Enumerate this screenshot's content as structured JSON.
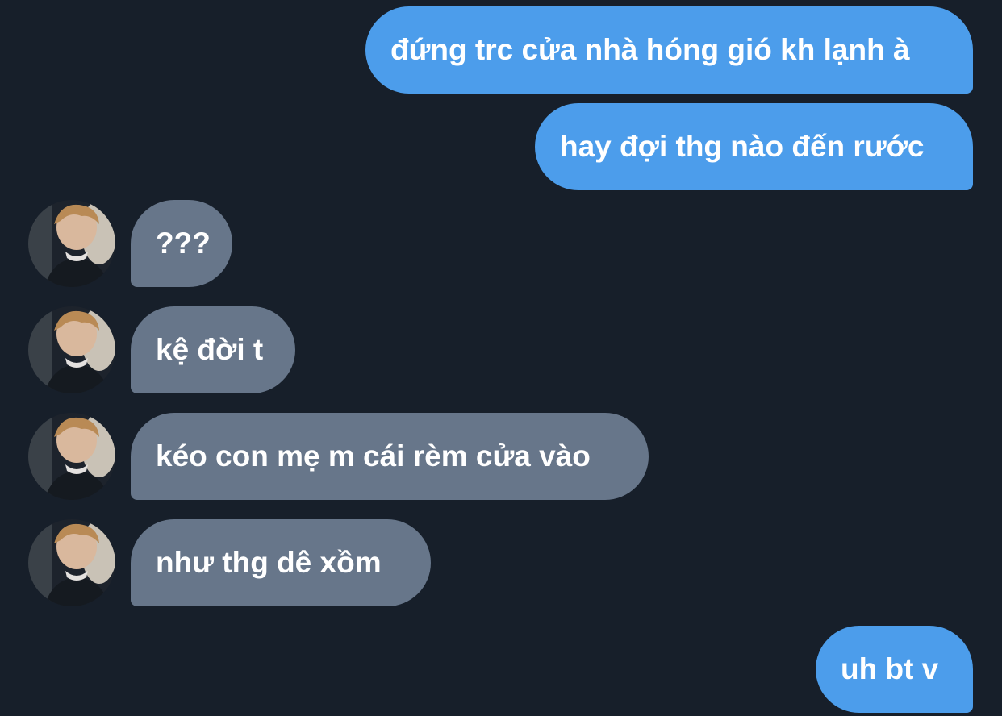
{
  "conversation": {
    "messages": [
      {
        "sender": "me",
        "text": "đứng trc cửa nhà hóng gió kh lạnh à"
      },
      {
        "sender": "me",
        "text": "hay đợi thg nào đến rước"
      },
      {
        "sender": "other",
        "text": "???"
      },
      {
        "sender": "other",
        "text": "kệ đời t"
      },
      {
        "sender": "other",
        "text": "kéo con mẹ m cái rèm cửa vào"
      },
      {
        "sender": "other",
        "text": "như thg dê xồm"
      },
      {
        "sender": "me",
        "text": "uh bt v"
      }
    ]
  },
  "colors": {
    "background": "#171f2a",
    "sent_bubble": "#4c9deb",
    "received_bubble": "#67768a",
    "text": "#ffffff"
  },
  "icons": {
    "avatar": "profile-photo-avatar-icon"
  }
}
